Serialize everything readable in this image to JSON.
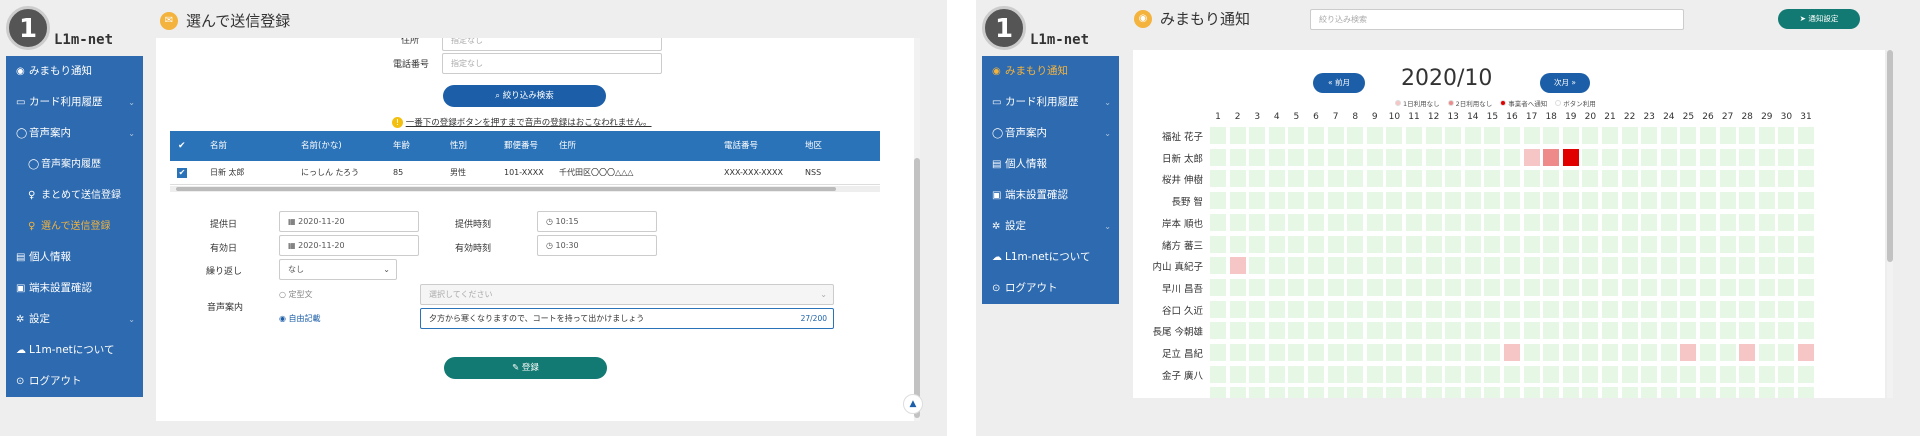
{
  "panel1": {
    "logo": {
      "numeral": "1",
      "brand": "L1m-net"
    },
    "header": {
      "title": "選んで送信登録",
      "icon": "envelope-icon"
    },
    "sidebar": [
      {
        "label": "みまもり通知",
        "icon": "eye-icon"
      },
      {
        "label": "カード利用履歴",
        "icon": "card-icon"
      },
      {
        "label": "音声案内",
        "icon": "speech-icon"
      },
      {
        "label": "音声案内履歴",
        "icon": "speech-icon",
        "sub": true
      },
      {
        "label": "まとめて送信登録",
        "icon": "bulb-icon",
        "sub": true
      },
      {
        "label": "選んで送信登録",
        "icon": "bulb-icon",
        "sub": true,
        "active": true
      },
      {
        "label": "個人情報",
        "icon": "doc-icon"
      },
      {
        "label": "端末設置確認",
        "icon": "file-check-icon"
      },
      {
        "label": "設定",
        "icon": "gear-icon"
      },
      {
        "label": "L1m-netについて",
        "icon": "cloud-icon"
      },
      {
        "label": "ログアウト",
        "icon": "logout-icon"
      }
    ],
    "search_form": {
      "address_label": "住所",
      "address_placeholder": "指定なし",
      "phone_label": "電話番号",
      "phone_placeholder": "指定なし",
      "search_button": "絞り込み検索",
      "warning": "一番下の登録ボタンを押すまで音声の登録はおこなわれません。"
    },
    "table": {
      "columns": [
        "名前",
        "名前(かな)",
        "年齢",
        "性別",
        "郵便番号",
        "住所",
        "電話番号",
        "地区"
      ],
      "rows": [
        {
          "checked": true,
          "cells": [
            "日新 太郎",
            "にっしん たろう",
            "85",
            "男性",
            "101-XXXX",
            "千代田区〇〇〇△△△",
            "XXX-XXX-XXXX",
            "NSS"
          ]
        }
      ]
    },
    "form": {
      "provide_date_label": "提供日",
      "provide_date": "2020-11-20",
      "provide_time_label": "提供時刻",
      "provide_time": "10:15",
      "valid_date_label": "有効日",
      "valid_date": "2020-11-20",
      "valid_time_label": "有効時刻",
      "valid_time": "10:30",
      "repeat_label": "繰り返し",
      "repeat_value": "なし",
      "voice_label": "音声案内",
      "fixed_label": "定型文",
      "fixed_placeholder": "選択してください",
      "free_label": "自由記載",
      "free_text": "夕方から寒くなりますので、コートを持って出かけましょう",
      "char_count": "27/200",
      "register_button": "登録"
    }
  },
  "panel2": {
    "logo": {
      "numeral": "1",
      "brand": "L1m-net"
    },
    "header": {
      "title": "みまもり通知",
      "icon": "eye-icon",
      "search_placeholder": "絞り込み検索",
      "settings_button": "通知設定"
    },
    "sidebar": [
      {
        "label": "みまもり通知",
        "icon": "eye-icon",
        "active": true
      },
      {
        "label": "カード利用履歴",
        "icon": "card-icon"
      },
      {
        "label": "音声案内",
        "icon": "speech-icon"
      },
      {
        "label": "個人情報",
        "icon": "doc-icon"
      },
      {
        "label": "端末設置確認",
        "icon": "file-check-icon"
      },
      {
        "label": "設定",
        "icon": "gear-icon"
      },
      {
        "label": "L1m-netについて",
        "icon": "cloud-icon"
      },
      {
        "label": "ログアウト",
        "icon": "logout-icon"
      }
    ],
    "calendar": {
      "month": "2020/10",
      "prev_button": "前月",
      "next_button": "次月",
      "legend": [
        {
          "label": "1日利用なし",
          "color": "#f6c6c6"
        },
        {
          "label": "2日利用なし",
          "color": "#ee8a8a"
        },
        {
          "label": "事業者へ通知",
          "color": "#e00000"
        },
        {
          "label": "ボタン利用",
          "color": "#ffffff"
        }
      ],
      "days": [
        "1",
        "2",
        "3",
        "4",
        "5",
        "6",
        "7",
        "8",
        "9",
        "10",
        "11",
        "12",
        "13",
        "14",
        "15",
        "16",
        "17",
        "18",
        "19",
        "20",
        "21",
        "22",
        "23",
        "24",
        "25",
        "26",
        "27",
        "28",
        "29",
        "30",
        "31"
      ],
      "people": [
        "福祉 花子",
        "日新 太郎",
        "桜井 伸樹",
        "長野 智",
        "岸本 順也",
        "緒方 蕃三",
        "内山 真紀子",
        "早川 昌吾",
        "谷口 久近",
        "長尾 今朝雄",
        "足立 昌紀",
        "金子 廣八"
      ],
      "marks": [
        {
          "row": 1,
          "day": 17,
          "level": 1
        },
        {
          "row": 1,
          "day": 18,
          "level": 2
        },
        {
          "row": 1,
          "day": 19,
          "level": 3
        },
        {
          "row": 6,
          "day": 2,
          "level": 1
        },
        {
          "row": 10,
          "day": 16,
          "level": 1
        },
        {
          "row": 10,
          "day": 25,
          "level": 1
        },
        {
          "row": 10,
          "day": 28,
          "level": 1
        },
        {
          "row": 10,
          "day": 31,
          "level": 1
        }
      ],
      "colors": {
        "empty": "#e6f7e6",
        "level1": "#f6c6c6",
        "level2": "#ee8a8a",
        "level3": "#e00000"
      }
    }
  }
}
